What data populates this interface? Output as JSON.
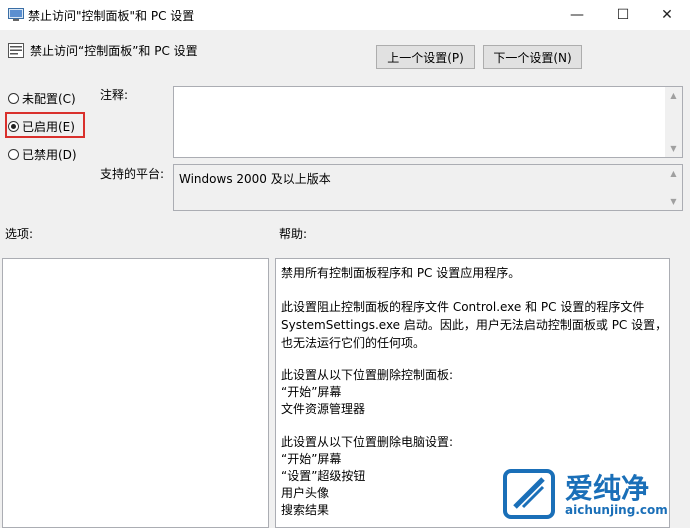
{
  "window": {
    "title": "禁止访问\"控制面板\"和 PC 设置",
    "minimize_glyph": "—",
    "maximize_glyph": "☐",
    "close_glyph": "✕"
  },
  "header": {
    "setting_name": "禁止访问“控制面板”和 PC 设置",
    "prev_button": "上一个设置(P)",
    "next_button": "下一个设置(N)"
  },
  "radios": [
    {
      "label": "未配置(C)",
      "checked": false
    },
    {
      "label": "已启用(E)",
      "checked": true
    },
    {
      "label": "已禁用(D)",
      "checked": false
    }
  ],
  "comment": {
    "label": "注释:",
    "value": ""
  },
  "platform": {
    "label": "支持的平台:",
    "value": "Windows 2000 及以上版本"
  },
  "options": {
    "label": "选项:"
  },
  "help": {
    "label": "帮助:",
    "lines": [
      "禁用所有控制面板程序和 PC 设置应用程序。",
      "",
      "此设置阻止控制面板的程序文件 Control.exe 和 PC 设置的程序文件",
      "SystemSettings.exe 启动。因此，用户无法启动控制面板或 PC 设置，",
      "也无法运行它们的任何项。",
      "",
      "此设置从以下位置删除控制面板:",
      "“开始”屏幕",
      "文件资源管理器",
      "",
      "此设置从以下位置删除电脑设置:",
      "“开始”屏幕",
      "“设置”超级按钮",
      "用户头像",
      "搜索结果"
    ]
  },
  "watermark": {
    "brand": "爱纯净",
    "url": "aichunjing.com"
  },
  "colors": {
    "highlight": "#d9302c",
    "brand_blue": "#1a6fb8"
  }
}
